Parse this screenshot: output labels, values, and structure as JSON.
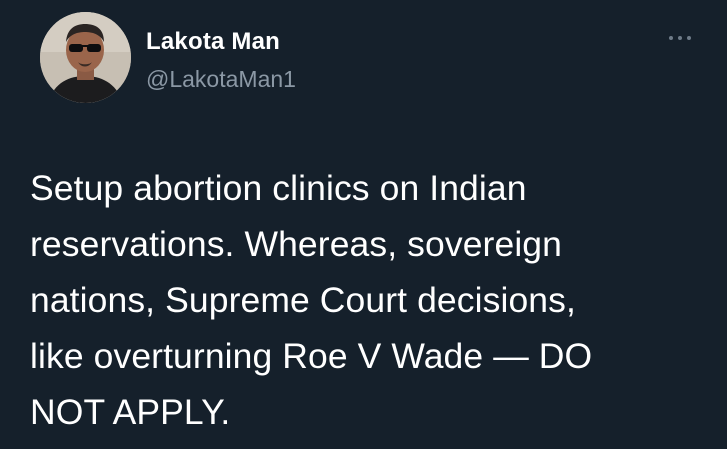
{
  "tweet": {
    "author": {
      "display_name": "Lakota Man",
      "handle": "@LakotaMan1",
      "avatar": "profile-photo"
    },
    "more_icon": "more-horizontal-icon",
    "text_lines": [
      "Setup abortion clinics on Indian",
      "reservations. Whereas, sovereign",
      "nations, Supreme Court decisions,",
      "like overturning Roe V Wade — DO",
      "NOT APPLY."
    ]
  },
  "colors": {
    "background": "#15202b",
    "text_primary": "#ffffff",
    "text_secondary": "#8b98a5"
  }
}
